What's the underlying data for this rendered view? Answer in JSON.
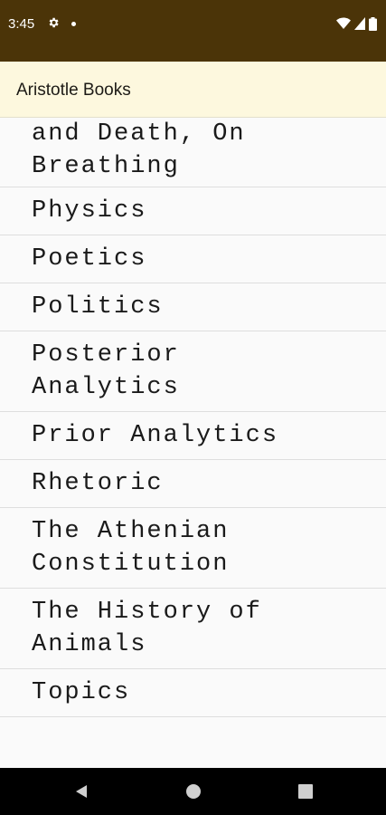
{
  "status_bar": {
    "time": "3:45",
    "icons": [
      "gear-icon",
      "notification-dot-icon",
      "wifi-icon",
      "signal-icon",
      "battery-icon"
    ]
  },
  "app_bar": {
    "title": "Aristotle Books"
  },
  "books": [
    {
      "label": "On Youth and Old Age, On Life and Death, On Breathing"
    },
    {
      "label": "Physics"
    },
    {
      "label": "Poetics"
    },
    {
      "label": "Politics"
    },
    {
      "label": "Posterior\nAnalytics"
    },
    {
      "label": "Prior Analytics"
    },
    {
      "label": "Rhetoric"
    },
    {
      "label": "The Athenian\nConstitution"
    },
    {
      "label": "The History of\nAnimals"
    },
    {
      "label": "Topics"
    }
  ],
  "nav_bar": {
    "icons": [
      "back-icon",
      "home-icon",
      "recents-icon"
    ]
  },
  "colors": {
    "status_bar": "#4b3408",
    "app_bar": "#fdf8de",
    "list_background": "#fafafa",
    "divider": "#dedede"
  }
}
